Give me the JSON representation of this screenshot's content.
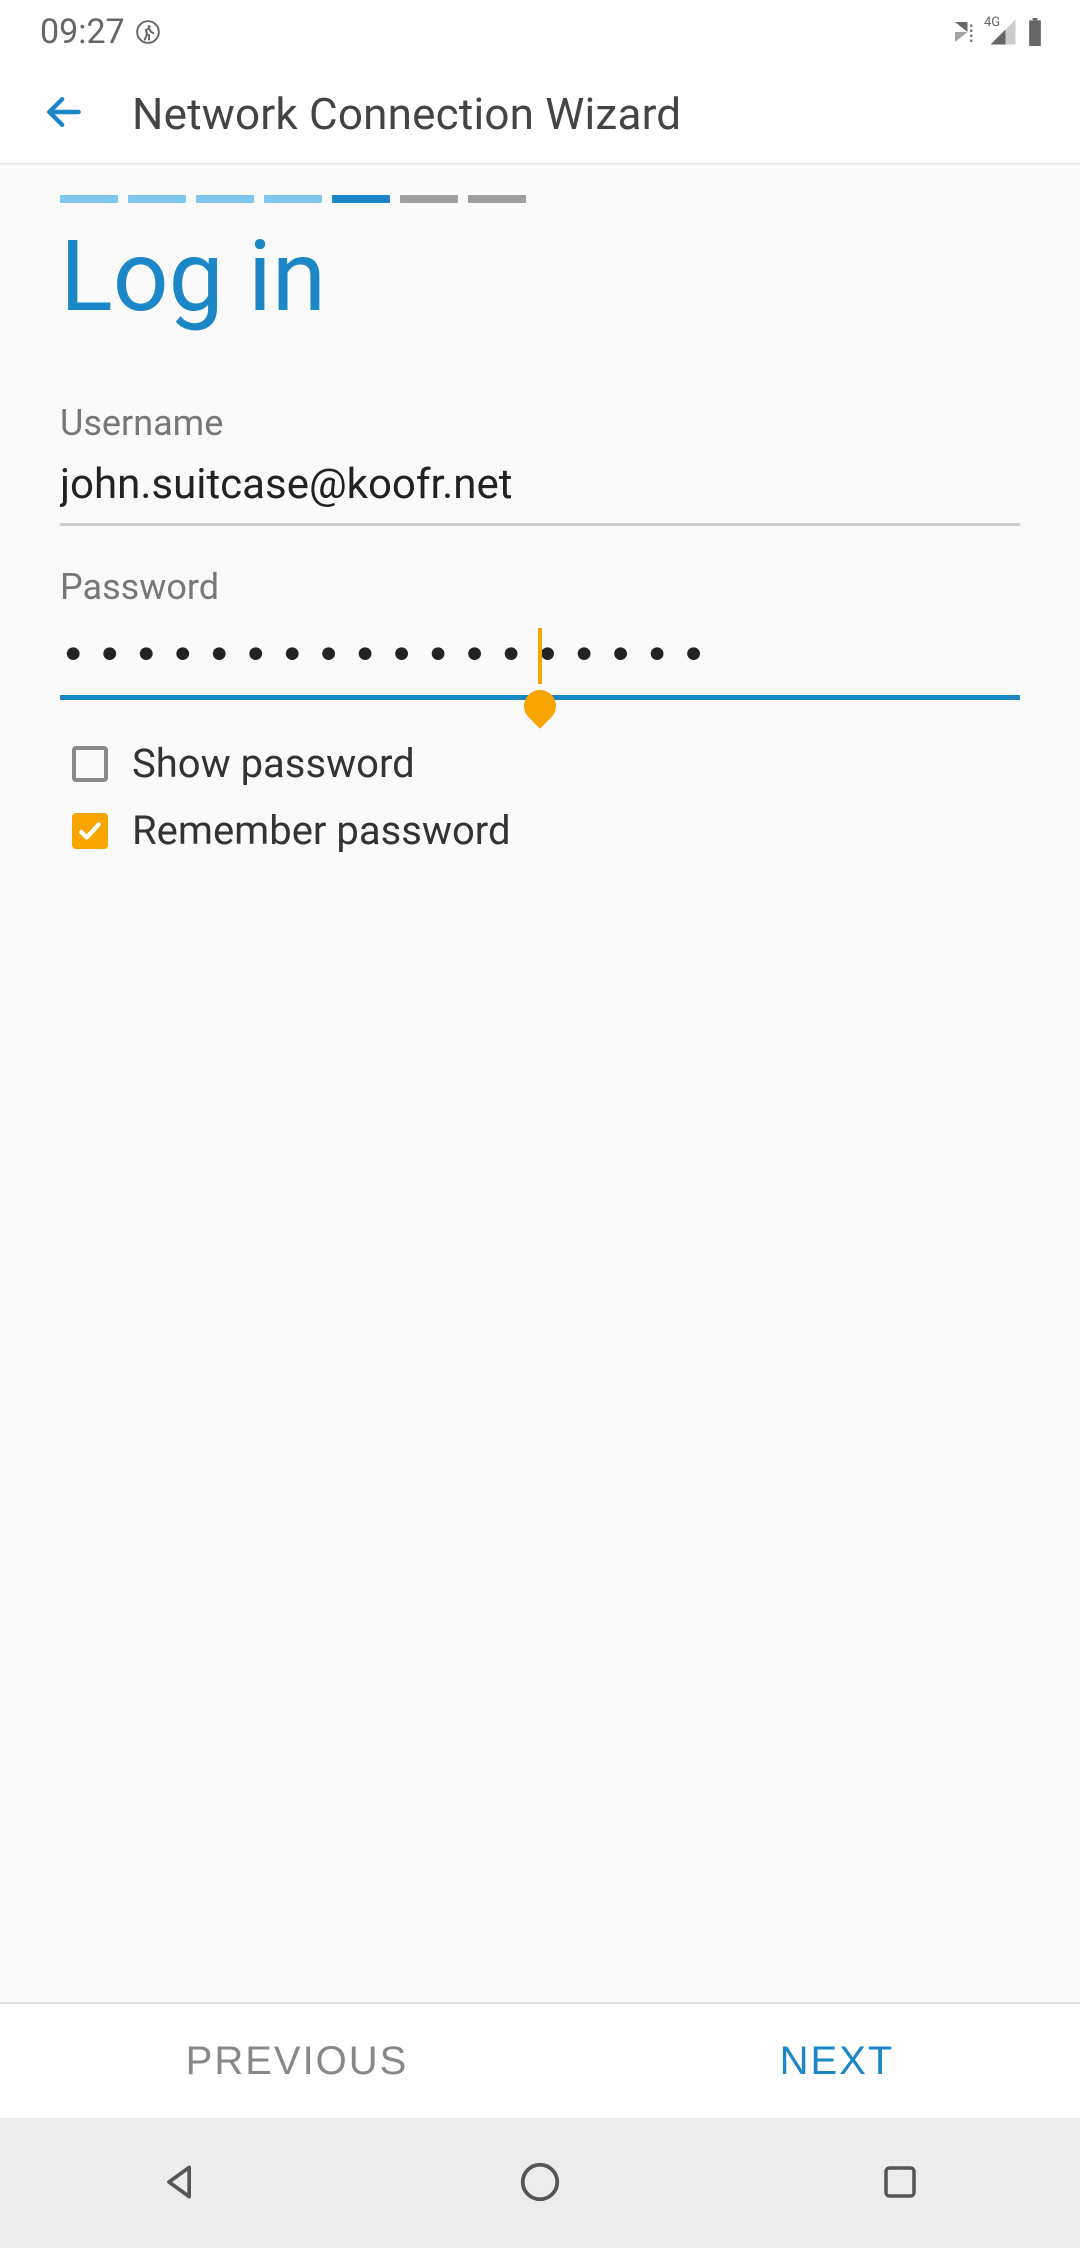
{
  "status_bar": {
    "time": "09:27",
    "network_label": "4G"
  },
  "header": {
    "title": "Network Connection Wizard"
  },
  "wizard": {
    "heading": "Log in",
    "progress": {
      "total": 7,
      "completed": 4,
      "active_index": 4
    },
    "username": {
      "label": "Username",
      "value": "john.suitcase@koofr.net"
    },
    "password": {
      "label": "Password",
      "masked_value": "••••••••••••••••••"
    },
    "show_password": {
      "label": "Show password",
      "checked": false
    },
    "remember_password": {
      "label": "Remember password",
      "checked": true
    }
  },
  "footer": {
    "previous": "PREVIOUS",
    "next": "NEXT"
  },
  "colors": {
    "accent": "#1b87c6",
    "cursor": "#f8a500"
  }
}
